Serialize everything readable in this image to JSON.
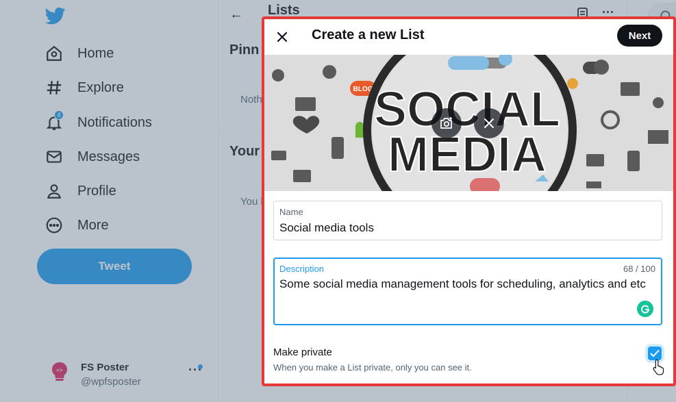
{
  "nav": {
    "items": [
      {
        "label": "Home",
        "icon": "home-icon"
      },
      {
        "label": "Explore",
        "icon": "hashtag-icon"
      },
      {
        "label": "Notifications",
        "icon": "bell-icon",
        "badge": "4"
      },
      {
        "label": "Messages",
        "icon": "envelope-icon"
      },
      {
        "label": "Profile",
        "icon": "person-icon"
      },
      {
        "label": "More",
        "icon": "more-circle-icon"
      }
    ],
    "tweet_label": "Tweet",
    "account": {
      "name": "FS Poster",
      "handle": "@wpfsposter"
    }
  },
  "page": {
    "title": "Lists",
    "pinned_heading": "Pinn",
    "nothing_text": "Noth",
    "your_heading": "Your",
    "you_text": "You l"
  },
  "modal": {
    "title": "Create a new List",
    "next_label": "Next",
    "banner_words": [
      "SOCIAL",
      "MEDIA"
    ],
    "name_label": "Name",
    "name_value": "Social media tools",
    "description_label": "Description",
    "description_count": "68 / 100",
    "description_value": "Some social media management tools for scheduling, analytics and etc",
    "private_label": "Make private",
    "private_sub": "When you make a List private, only you can see it.",
    "private_checked": true
  },
  "colors": {
    "accent": "#1d9bf0",
    "highlight_border": "#e63a3a",
    "grammarly": "#15c39a"
  }
}
